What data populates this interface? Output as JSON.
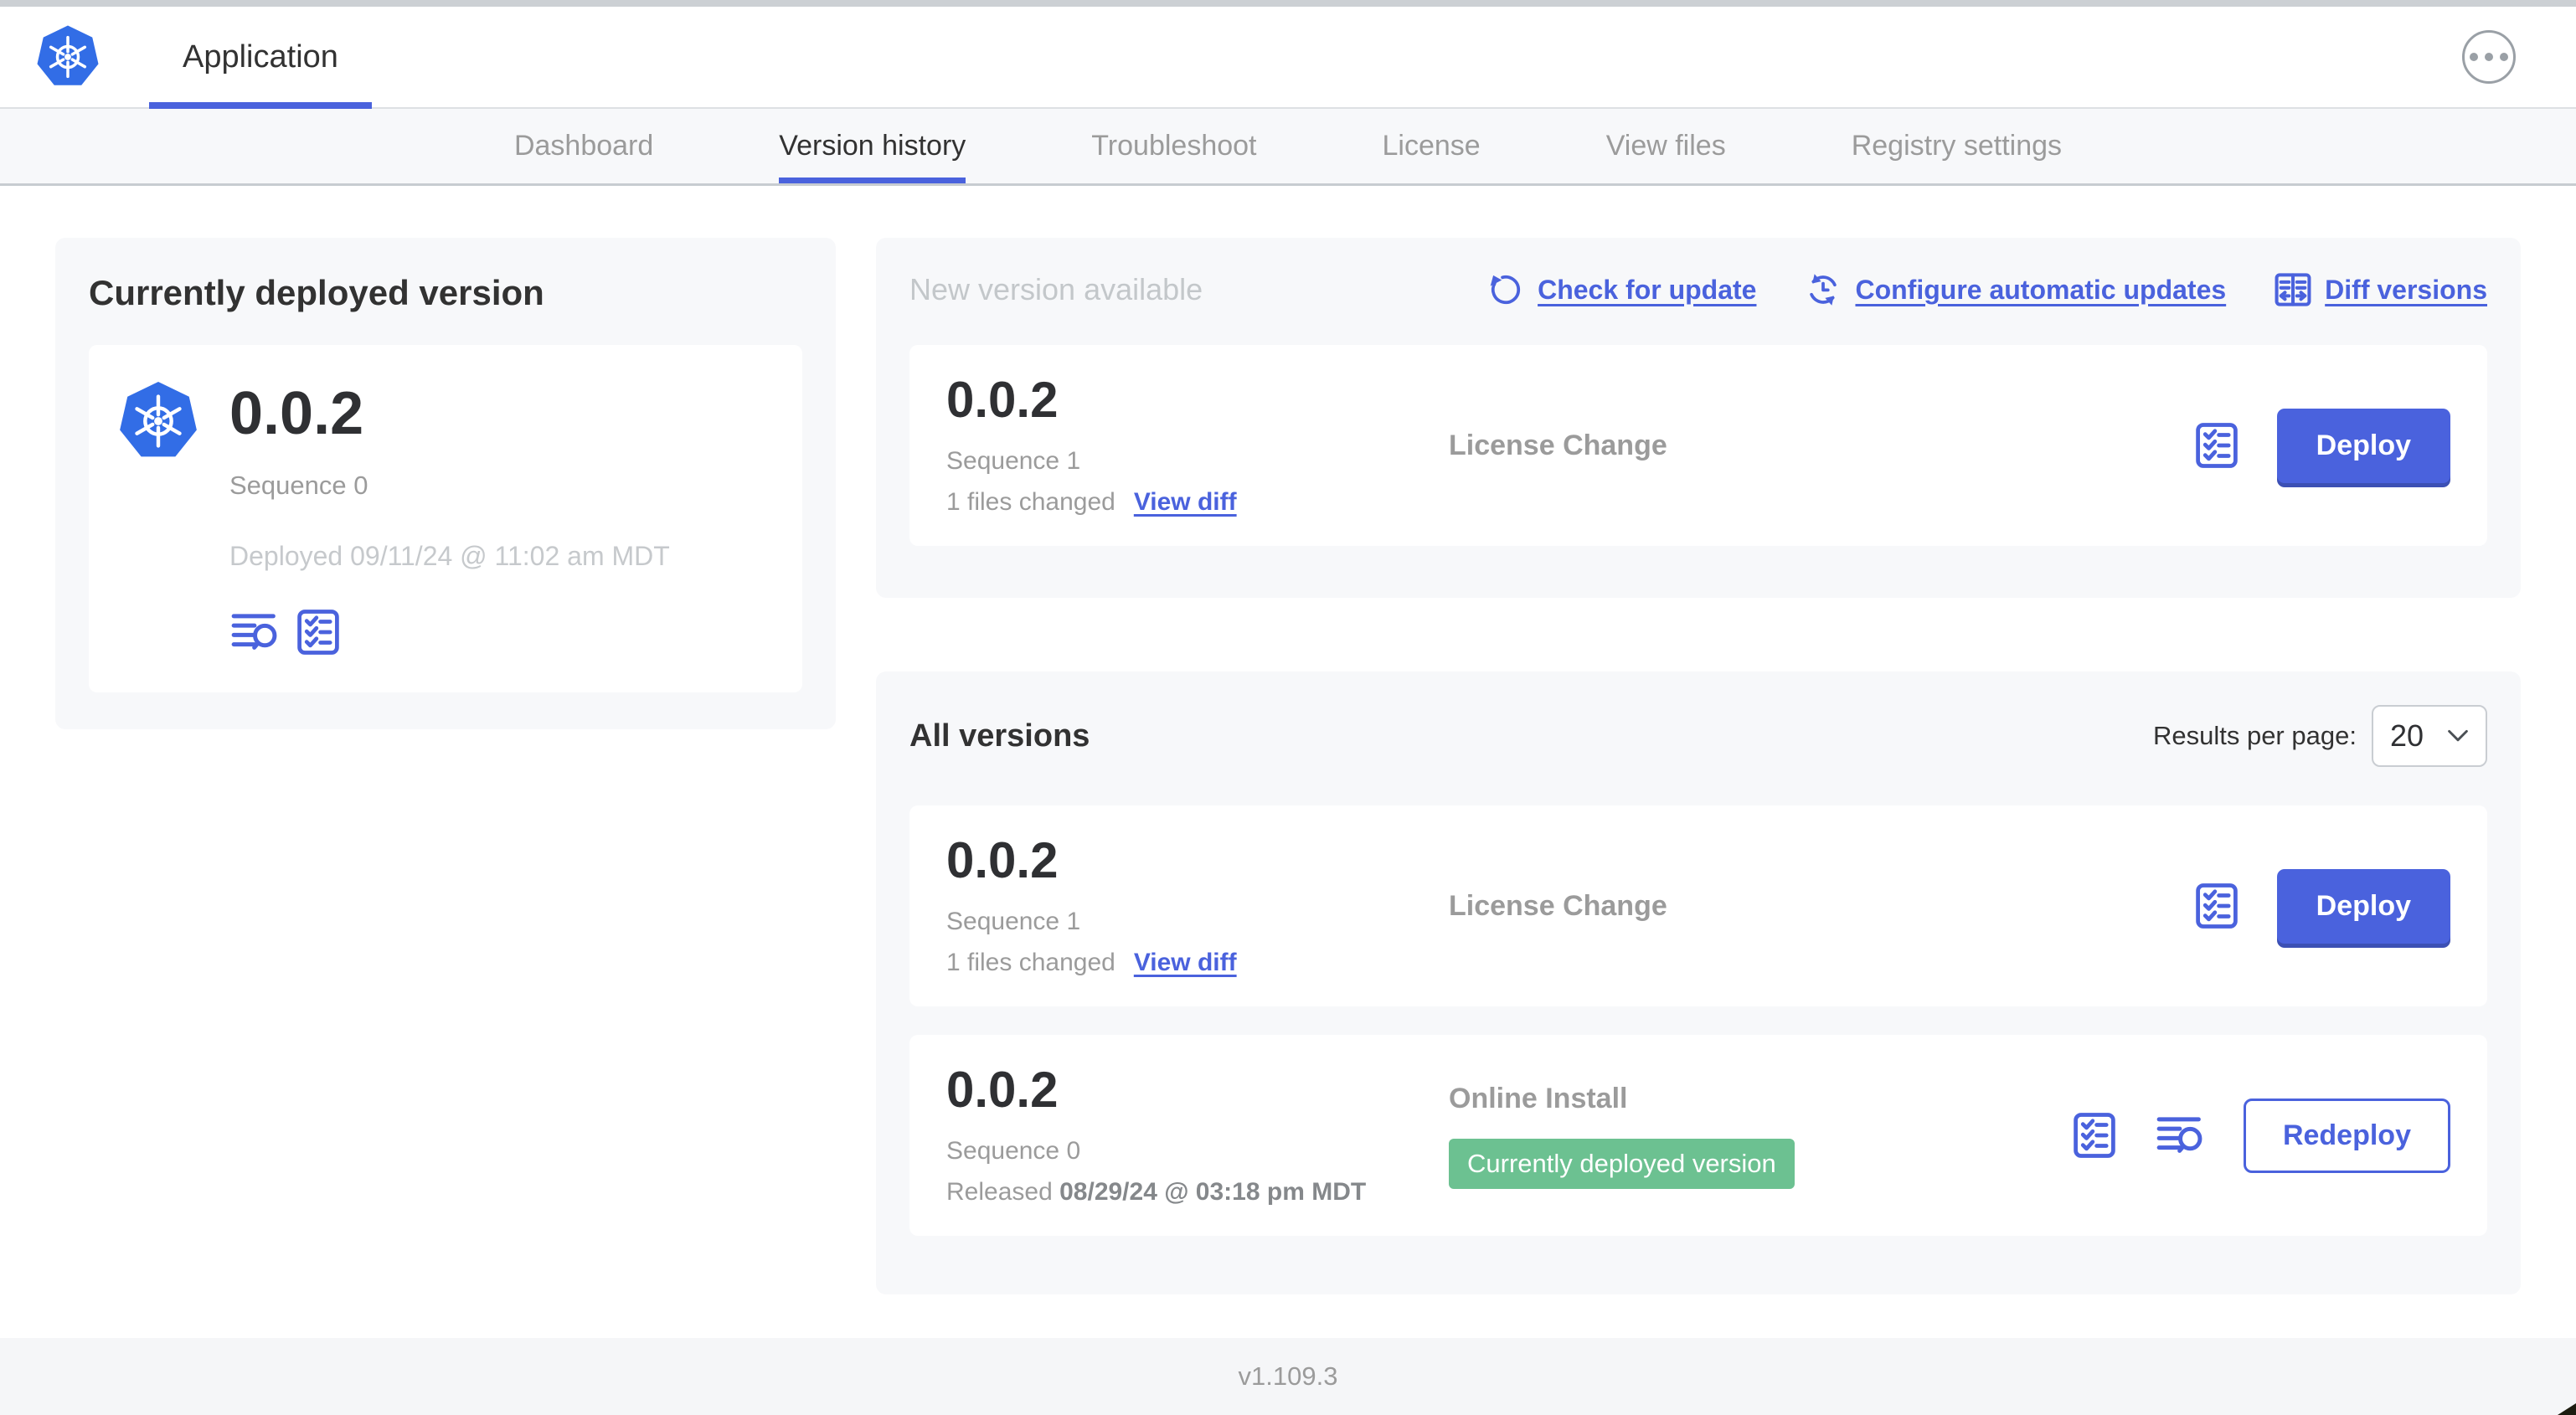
{
  "app_bar": {
    "tab_label": "Application",
    "menu_icon": "ellipsis-circle-icon",
    "logo_icon": "kubernetes-logo"
  },
  "nav": {
    "items": [
      "Dashboard",
      "Version history",
      "Troubleshoot",
      "License",
      "View files",
      "Registry settings"
    ],
    "active_item": "Version history"
  },
  "current_panel": {
    "title": "Currently deployed version",
    "version": "0.0.2",
    "sequence": "Sequence 0",
    "deployed_timestamp": "Deployed 09/11/24 @ 11:02 am MDT",
    "icons": [
      "logs-icon",
      "preflight-checklist-icon"
    ]
  },
  "new_version_panel": {
    "title": "New version available",
    "check_for_update": "Check for update",
    "configure_automatic_updates": "Configure automatic updates",
    "diff_versions": "Diff versions",
    "row": {
      "version": "0.0.2",
      "sequence": "Sequence 1",
      "files_changed": "1 files changed",
      "view_diff": "View diff",
      "source": "License Change",
      "action_label": "Deploy"
    }
  },
  "all_versions_panel": {
    "title": "All versions",
    "results_per_page_label": "Results per page:",
    "results_per_page_value": "20",
    "rows": [
      {
        "version": "0.0.2",
        "sequence": "Sequence 1",
        "files_changed": "1 files changed",
        "view_diff": "View diff",
        "source": "License Change",
        "action_label": "Deploy"
      },
      {
        "version": "0.0.2",
        "sequence": "Sequence 0",
        "released_label": "Released",
        "released_date": "08/29/24 @ 03:18 pm MDT",
        "source": "Online Install",
        "badge": "Currently deployed version",
        "action_label": "Redeploy"
      }
    ]
  },
  "footer": {
    "app_manager_version": "v1.109.3"
  },
  "colors": {
    "primary_blue": "#4A62DD",
    "kubernetes_blue": "#326DE6",
    "badge_green": "#6CC191",
    "muted_gray": "#9b9b9b"
  }
}
